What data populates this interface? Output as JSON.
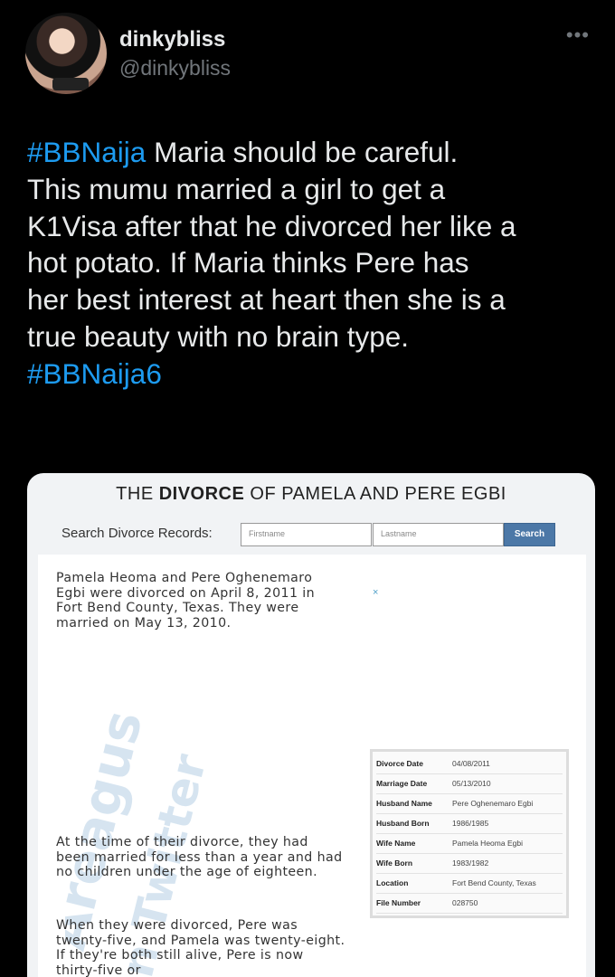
{
  "user": {
    "display_name": "dinkybliss",
    "handle": "@dinkybliss",
    "more_label": "•••"
  },
  "tweet": {
    "lines": [
      [
        {
          "t": "#BBNaija",
          "h": true
        },
        {
          "t": " Maria should be careful.",
          "h": false
        }
      ],
      [
        {
          "t": "This mumu married a girl to get a",
          "h": false
        }
      ],
      [
        {
          "t": "K1Visa after that he divorced her like a",
          "h": false
        }
      ],
      [
        {
          "t": "hot potato. If Maria thinks Pere has",
          "h": false
        }
      ],
      [
        {
          "t": "her best interest at heart then she is a",
          "h": false
        }
      ],
      [
        {
          "t": "true beauty with no brain type.",
          "h": false
        }
      ],
      [
        {
          "t": "#BBNaija6",
          "h": true
        }
      ]
    ]
  },
  "media": {
    "title_pre": "THE ",
    "title_bold": "DIVORCE",
    "title_post": " OF PAMELA AND PERE EGBI",
    "search_label": "Search Divorce Records:",
    "firstname_placeholder": "Firstname",
    "lastname_placeholder": "Lastname",
    "search_button": "Search",
    "close_label": "×",
    "paragraph1": "Pamela Heoma and Pere Oghenemaro Egbi were divorced on April 8, 2011 in Fort Bend County, Texas. They were married on May 13, 2010.",
    "paragraph2": "At the time of their divorce, they had been married for less than a year and had no children under the age of eighteen.",
    "paragraph3": "When they were divorced, Pere was twenty-five, and Pamela was twenty-eight. If they're both still alive, Pere is now thirty-five or",
    "watermark_lines": [
      "Areagus",
      "n Twitter"
    ],
    "records": [
      {
        "label": "Divorce Date",
        "value": "04/08/2011"
      },
      {
        "label": "Marriage Date",
        "value": "05/13/2010"
      },
      {
        "label": "Husband Name",
        "value": "Pere Oghenemaro Egbi"
      },
      {
        "label": "Husband Born",
        "value": "1986/1985"
      },
      {
        "label": "Wife Name",
        "value": "Pamela Heoma Egbi"
      },
      {
        "label": "Wife Born",
        "value": "1983/1982"
      },
      {
        "label": "Location",
        "value": "Fort Bend County, Texas"
      },
      {
        "label": "File Number",
        "value": "028750"
      }
    ]
  }
}
